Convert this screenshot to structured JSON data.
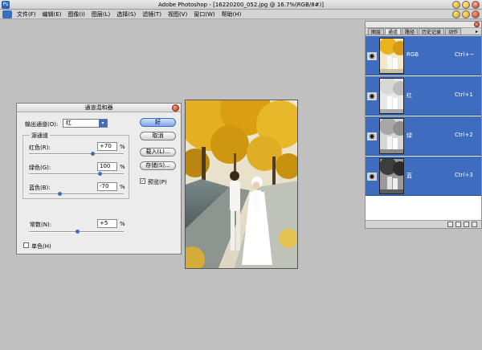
{
  "window": {
    "title": "Adobe Photoshop - [16220200_052.jpg @ 16.7%(RGB/8#)]",
    "app_icon_glyph": "Ps",
    "minimize_glyph": "–",
    "maximize_glyph": "□",
    "close_glyph": "×"
  },
  "menu": {
    "items": [
      "文件(F)",
      "编辑(E)",
      "图像(I)",
      "图层(L)",
      "选择(S)",
      "滤镜(T)",
      "视图(V)",
      "窗口(W)",
      "帮助(H)"
    ]
  },
  "channels_palette": {
    "tabs": [
      "图层",
      "通道",
      "路径",
      "历史记录",
      "动作"
    ],
    "active_tab": "通道",
    "menu_glyph": "▸",
    "eye_glyph": "◉",
    "channels": [
      {
        "name": "RGB",
        "shortcut": "Ctrl+~"
      },
      {
        "name": "红",
        "shortcut": "Ctrl+1"
      },
      {
        "name": "绿",
        "shortcut": "Ctrl+2"
      },
      {
        "name": "蓝",
        "shortcut": "Ctrl+3"
      }
    ],
    "bottom_icons": [
      "load-selection-icon",
      "save-selection-icon",
      "new-channel-icon",
      "delete-channel-icon"
    ]
  },
  "channel_mixer": {
    "title": "通道混和器",
    "output_channel_label": "输出通道(O):",
    "output_channel_value": "红",
    "source_group_title": "源通道",
    "red_label": "红色(R):",
    "red_value": "+70",
    "green_label": "绿色(G):",
    "green_value": "100",
    "blue_label": "蓝色(B):",
    "blue_value": "-70",
    "constant_label": "常数(N):",
    "constant_value": "+5",
    "percent": "%",
    "monochrome_label": "单色(H)",
    "monochrome_checked": false,
    "ok_label": "好",
    "cancel_label": "取消",
    "load_label": "载入(L)...",
    "save_label": "存储(S)...",
    "preview_label": "预览(P)",
    "preview_checked": true,
    "check_glyph": "✓",
    "slider_levels": {
      "red": 70,
      "green": 100,
      "blue": -70,
      "constant": 5
    },
    "slider_range": [
      -200,
      200
    ]
  }
}
